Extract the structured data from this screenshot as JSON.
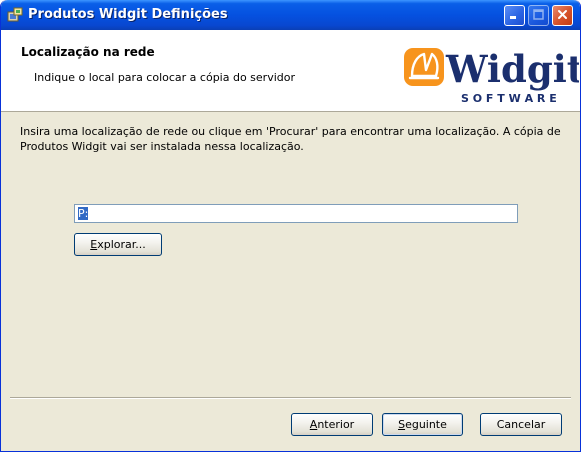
{
  "window": {
    "title": "Produtos Widgit Definições",
    "app_icon": "installer-icon",
    "controls": {
      "minimize_icon": "minimize-icon",
      "maximize_icon": "maximize-icon",
      "close_icon": "close-icon"
    }
  },
  "header": {
    "title": "Localização na rede",
    "subtitle": "Indique o local para colocar a cópia do servidor",
    "logo": {
      "wordmark": "Widgit",
      "tagline": "S O F T W A R E"
    }
  },
  "main": {
    "instructions": "Insira uma localização de rede ou clique em 'Procurar' para encontrar uma localização. A cópia de Produtos Widgit vai ser instalada nessa localização.",
    "path_field": {
      "value": "P:"
    },
    "browse_button": {
      "mnemonic": "E",
      "rest": "xplorar..."
    }
  },
  "footer": {
    "back_button": {
      "mnemonic": "A",
      "rest": "nterior"
    },
    "next_button": {
      "mnemonic": "S",
      "rest": "eguinte"
    },
    "cancel_button": {
      "label": "Cancelar"
    }
  },
  "colors": {
    "titlebar": "#0551e0",
    "dialog_bg": "#ece9d8",
    "logo_orange": "#f7941d",
    "logo_navy": "#1b2f6e",
    "selection": "#316ac5"
  }
}
